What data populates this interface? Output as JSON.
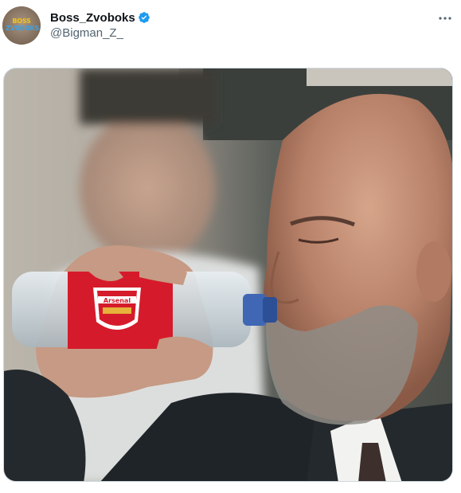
{
  "tweet": {
    "avatar": {
      "line1": "BOSS",
      "line2": "ZVOBOKS"
    },
    "author": {
      "display_name": "Boss_Zvoboks",
      "handle": "@Bigman_Z_",
      "verified": true
    },
    "more_icon": "more-horizontal-icon",
    "verified_icon": "verified-badge-icon",
    "verified_color": "#1d9bf0",
    "media": {
      "description_icon": "photo",
      "bottle_label_text": "Arsenal",
      "label_color": "#d51b2b"
    }
  }
}
